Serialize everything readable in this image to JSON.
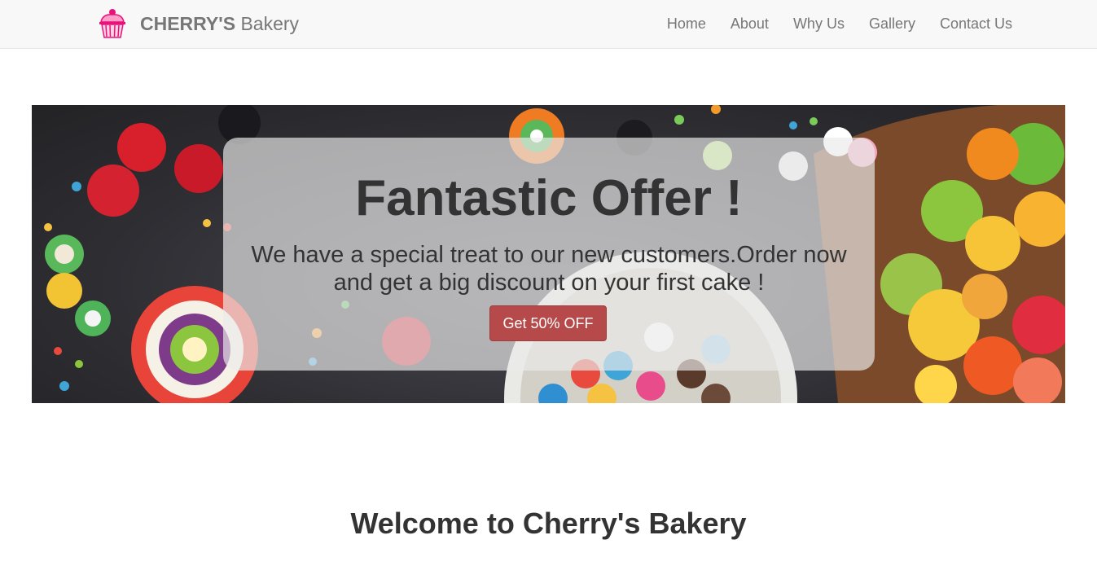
{
  "navbar": {
    "brand_bold": "CHERRY'S",
    "brand_light": " Bakery",
    "logo_icon": "cupcake-icon",
    "items": [
      {
        "label": "Home"
      },
      {
        "label": "About"
      },
      {
        "label": "Why Us"
      },
      {
        "label": "Gallery"
      },
      {
        "label": "Contact Us"
      }
    ]
  },
  "hero": {
    "title": "Fantastic Offer !",
    "text": "We have a special treat to our new customers.Order now and get a big discount on your first cake !",
    "button_label": "Get 50% OFF",
    "button_color": "#b64a4a"
  },
  "welcome": {
    "heading": "Welcome to Cherry's Bakery"
  }
}
